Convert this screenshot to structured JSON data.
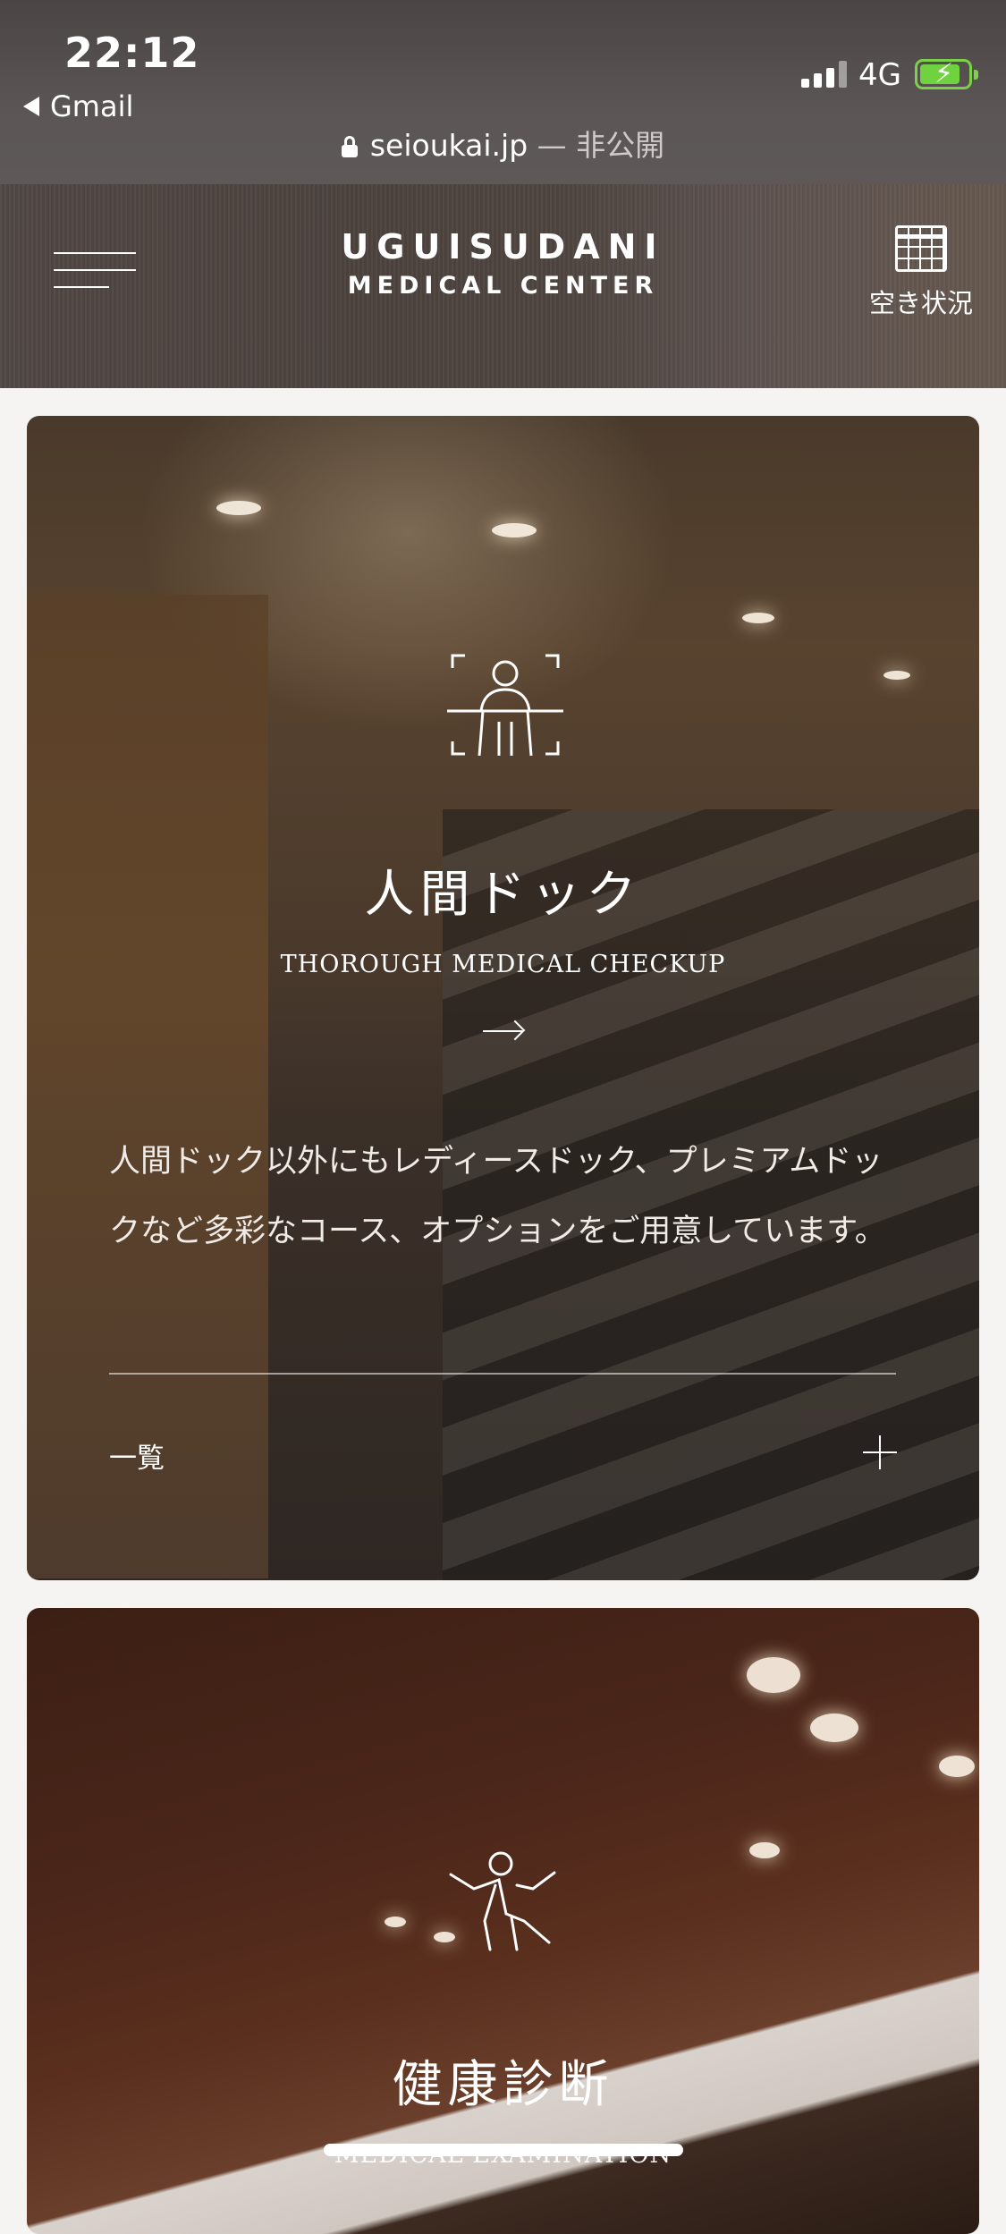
{
  "status_bar": {
    "time": "22:12",
    "back_app": "Gmail",
    "network": "4G",
    "url_domain": "seioukai.jp",
    "url_suffix": "— 非公開"
  },
  "header": {
    "logo_line1": "UGUISUDANI",
    "logo_line2": "MEDICAL CENTER",
    "calendar_label": "空き状況"
  },
  "cards": [
    {
      "icon": "person-scan-icon",
      "title": "人間ドック",
      "subtitle": "THOROUGH MEDICAL CHECKUP",
      "description": "人間ドック以外にもレディースドック、プレミアムドックなど多彩なコース、オプションをご用意しています。",
      "list_label": "一覧"
    },
    {
      "icon": "person-stretch-icon",
      "title": "健康診断",
      "subtitle": "MEDICAL EXAMINATION"
    }
  ],
  "colors": {
    "battery": "#6fd23e",
    "page_bg": "#f6f3f3"
  }
}
